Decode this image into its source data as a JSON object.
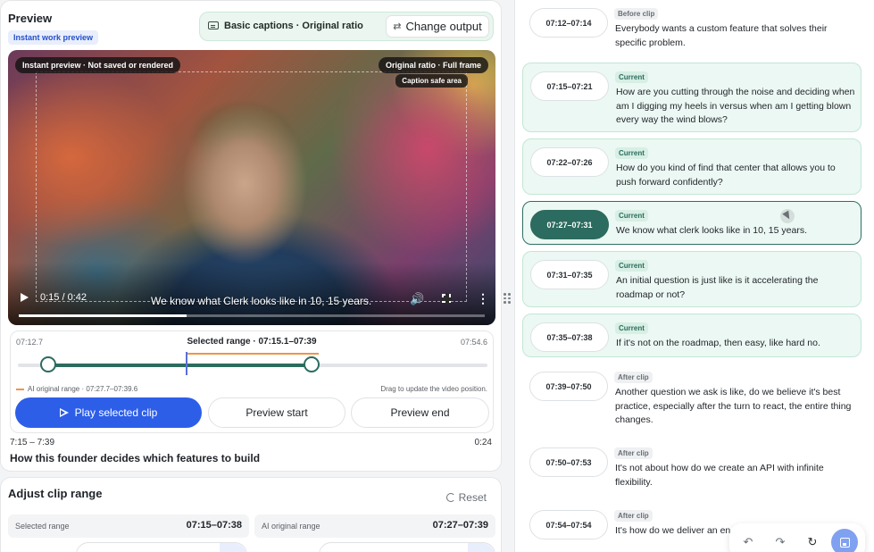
{
  "preview": {
    "title": "Preview",
    "badge": "Instant work preview",
    "output_label": "Basic captions · Original ratio",
    "change_output": "Change output"
  },
  "video": {
    "tag_instant": "Instant preview · Not saved or rendered",
    "tag_ratio": "Original ratio · Full frame",
    "tag_safe": "Caption safe area",
    "time": "0:15 / 0:42",
    "caption": "We know what Clerk looks like in 10, 15 years.",
    "progress": 0.36
  },
  "range": {
    "start": "07:12.7",
    "end": "07:54.6",
    "title": "Selected range · 07:15.1–07:39",
    "ai_legend": "AI original range · 07:27.7–07:39.6",
    "drag_hint": "Drag to update the video position.",
    "play_selected": "Play selected clip",
    "preview_start": "Preview start",
    "preview_end": "Preview end",
    "selection_start_fraction": 0.064,
    "selection_end_fraction": 0.626,
    "ai_start_fraction": 0.358,
    "ai_end_fraction": 0.64,
    "playhead_fraction": 0.358
  },
  "clip": {
    "time": "7:15 – 7:39",
    "duration": "0:24",
    "title": "How this founder decides which features to build"
  },
  "adjust": {
    "title": "Adjust clip range",
    "reset": "Reset",
    "selected_label": "Selected range",
    "selected_value": "07:15–07:38",
    "ai_label": "AI original range",
    "ai_value": "07:27–07:39"
  },
  "segments": [
    {
      "ts": "07:12–07:14",
      "badge": "Before clip",
      "text": "Everybody wants a custom feature that solves their specific problem.",
      "state": "plain"
    },
    {
      "ts": "07:15–07:21",
      "badge": "Current",
      "text": "How are you cutting through the noise and deciding when am I digging my heels in versus when am I getting blown every way the wind blows?",
      "state": "cur"
    },
    {
      "ts": "07:22–07:26",
      "badge": "Current",
      "text": "How do you kind of find that center that allows you to push forward confidently?",
      "state": "cur"
    },
    {
      "ts": "07:27–07:31",
      "badge": "Current",
      "text": "We know what clerk looks like in 10, 15 years.",
      "state": "active"
    },
    {
      "ts": "07:31–07:35",
      "badge": "Current",
      "text": "An initial question is just like is it accelerating the roadmap or not?",
      "state": "cur"
    },
    {
      "ts": "07:35–07:38",
      "badge": "Current",
      "text": "If it's not on the roadmap, then easy, like hard no.",
      "state": "cur"
    },
    {
      "ts": "07:39–07:50",
      "badge": "After clip",
      "text": "Another question we ask is like, do we believe it's best practice, especially after the turn to react, the entire thing changes.",
      "state": "plain"
    },
    {
      "ts": "07:50–07:53",
      "badge": "After clip",
      "text": "It's not about how do we create an API with infinite flexibility.",
      "state": "plain"
    },
    {
      "ts": "07:54–07:54",
      "badge": "After clip",
      "text": "It's how do we deliver an en customers, right?",
      "state": "plain"
    }
  ],
  "toolbar": {
    "undo": "↶",
    "redo": "↷",
    "refresh": "↻"
  },
  "colors": {
    "accent": "#2d5ee8",
    "green": "#2c6b5f",
    "ai_orange": "#ef9549"
  }
}
